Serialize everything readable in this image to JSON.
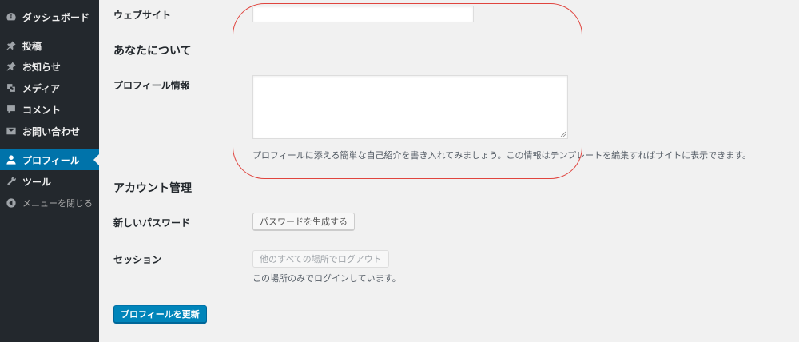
{
  "sidebar": {
    "items": [
      {
        "label": "ダッシュボード",
        "icon": "dashboard-icon"
      },
      {
        "label": "投稿",
        "icon": "pin-icon"
      },
      {
        "label": "お知らせ",
        "icon": "pin-icon"
      },
      {
        "label": "メディア",
        "icon": "media-icon"
      },
      {
        "label": "コメント",
        "icon": "comment-icon"
      },
      {
        "label": "お問い合わせ",
        "icon": "mail-icon"
      },
      {
        "label": "プロフィール",
        "icon": "user-icon"
      },
      {
        "label": "ツール",
        "icon": "wrench-icon"
      },
      {
        "label": "メニューを閉じる",
        "icon": "collapse-icon"
      }
    ],
    "current_index": 6,
    "colors": {
      "background": "#23282d",
      "current": "#0073aa"
    }
  },
  "form": {
    "website": {
      "label": "ウェブサイト",
      "value": ""
    },
    "about_title": "あなたについて",
    "bio": {
      "label": "プロフィール情報",
      "value": "",
      "description": "プロフィールに添える簡単な自己紹介を書き入れてみましょう。この情報はテンプレートを編集すればサイトに表示できます。"
    },
    "account_title": "アカウント管理",
    "password": {
      "label": "新しいパスワード",
      "button": "パスワードを生成する"
    },
    "sessions": {
      "label": "セッション",
      "button": "他のすべての場所でログアウト",
      "description": "この場所のみでログインしています。"
    },
    "submit": "プロフィールを更新"
  },
  "annotation_color": "#e0443e"
}
